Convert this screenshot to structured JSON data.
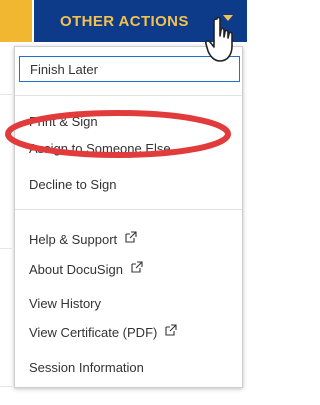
{
  "header": {
    "button_label": "OTHER ACTIONS",
    "caret_icon": "caret-down-icon",
    "cursor_icon": "hand-pointer-icon",
    "colors": {
      "background": "#0e3a8a",
      "text": "#f2c14e",
      "yellow_tab": "#f2b731"
    }
  },
  "menu": {
    "finish_later": "Finish Later",
    "group2": [
      {
        "label": "Print & Sign"
      },
      {
        "label": "Assign to Someone Else"
      },
      {
        "label": "Decline to Sign"
      }
    ],
    "group3": [
      {
        "label": "Help & Support",
        "icon": "external-link-icon"
      },
      {
        "label": "About DocuSign",
        "icon": "external-link-icon"
      },
      {
        "label": "View History",
        "icon": ""
      },
      {
        "label": "View Certificate (PDF)",
        "icon": "external-link-icon"
      },
      {
        "label": "Session Information",
        "icon": ""
      }
    ],
    "highlight_color": "#e23b3b",
    "focus_color": "#1f6fd1"
  }
}
